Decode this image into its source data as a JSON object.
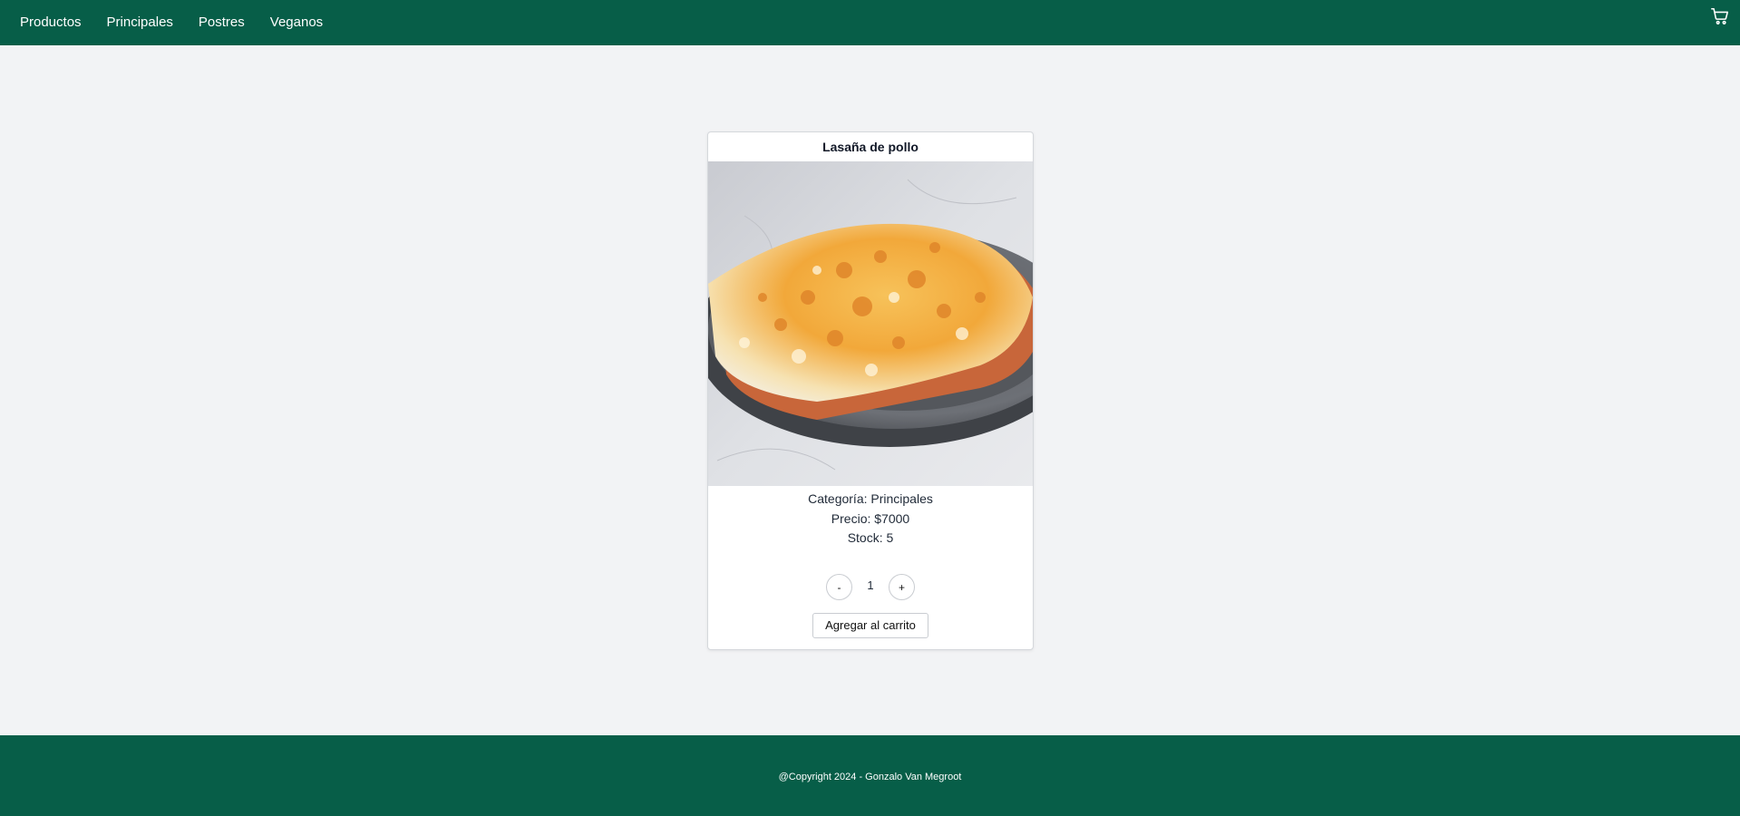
{
  "nav": {
    "links": [
      {
        "label": "Productos"
      },
      {
        "label": "Principales"
      },
      {
        "label": "Postres"
      },
      {
        "label": "Veganos"
      }
    ],
    "cart_icon": "shopping-cart-icon"
  },
  "product": {
    "title": "Lasaña de pollo",
    "image_subject": "lasagna-dish",
    "category_line": "Categoría: Principales",
    "price_line": "Precio: $7000",
    "stock_line": "Stock: 5",
    "quantity": "1",
    "decrement_label": "-",
    "increment_label": "+",
    "add_to_cart_label": "Agregar al carrito"
  },
  "footer": {
    "copyright": "@Copyright 2024 - Gonzalo Van Megroot"
  },
  "colors": {
    "brand": "#075e48",
    "background": "#f2f3f5"
  }
}
